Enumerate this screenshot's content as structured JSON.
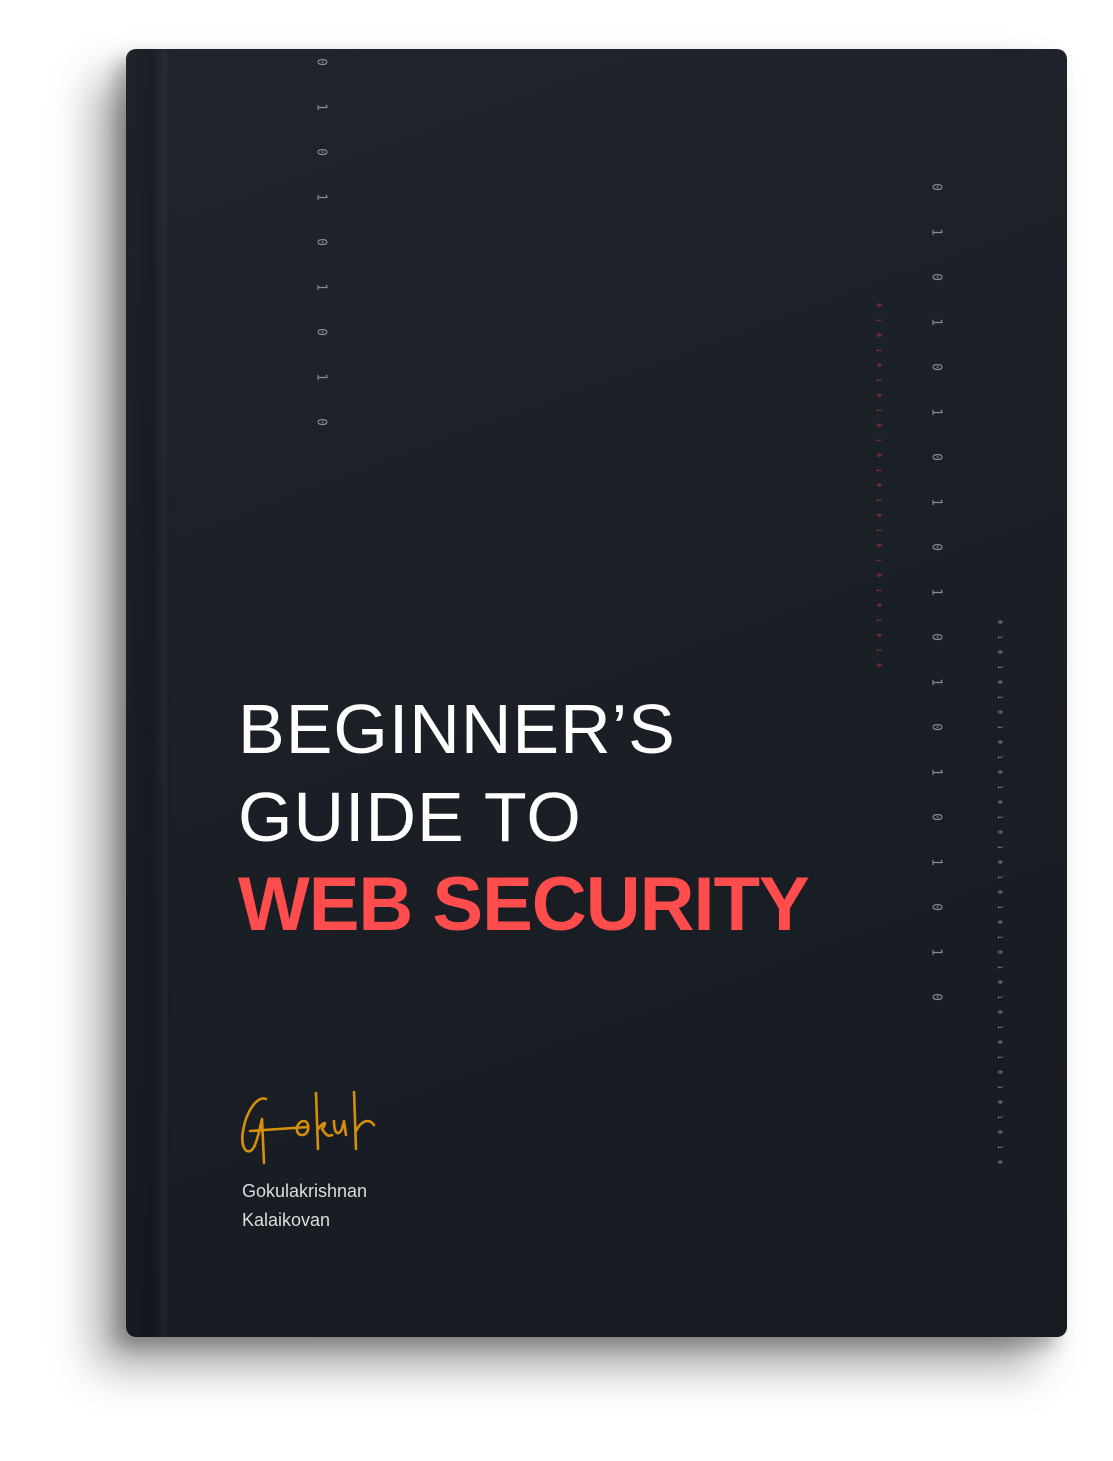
{
  "cover": {
    "title_line1": "BEGINNER’S",
    "title_line2": "GUIDE TO",
    "title_line3": "WEB SECURITY",
    "signature": "Gokul",
    "author_first": "Gokulakrishnan",
    "author_last": "Kalaikovan"
  },
  "binary_columns": [
    {
      "digits": "010101010",
      "color": "#8a8d92"
    },
    {
      "digits": "0101010101010101010",
      "color": "#8a8d92"
    },
    {
      "digits": "0101010101010101010101010",
      "color": "#c0363a"
    },
    {
      "digits": "0101010101010101010101010101010101010",
      "color": "#9a9da2"
    }
  ],
  "colors": {
    "accent": "#ff4c4c",
    "signature": "#d68f0b",
    "background": "#1b1f26"
  }
}
